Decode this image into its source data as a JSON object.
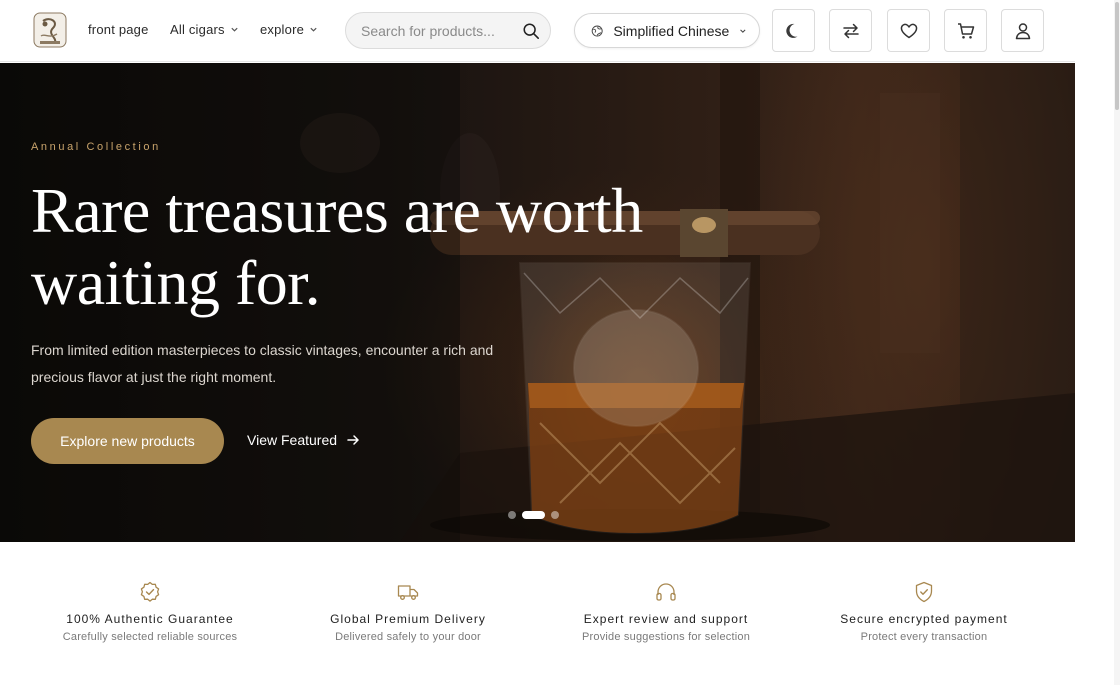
{
  "header": {
    "logo_label": "Cigar shop logo",
    "nav": [
      {
        "label": "front page",
        "has_dropdown": false
      },
      {
        "label": "All cigars",
        "has_dropdown": true
      },
      {
        "label": "explore",
        "has_dropdown": true
      }
    ],
    "search": {
      "placeholder": "Search for products...",
      "value": ""
    },
    "language": {
      "label": "Simplified Chinese"
    },
    "icons": [
      "moon-icon",
      "compare-icon",
      "heart-icon",
      "cart-icon",
      "user-icon"
    ]
  },
  "hero": {
    "eyebrow": "Annual Collection",
    "headline_line1": "Rare treasures are worth",
    "headline_line2": "waiting for.",
    "subtext": "From limited edition masterpieces to classic vintages, encounter a rich and precious flavor at just the right moment.",
    "primary_cta": "Explore new products",
    "secondary_cta": "View Featured",
    "slides": {
      "count": 3,
      "active": 2
    }
  },
  "features": [
    {
      "title": "100% Authentic Guarantee",
      "description": "Carefully selected reliable sources",
      "icon": "badge-check-icon"
    },
    {
      "title": "Global Premium Delivery",
      "description": "Delivered safely to your door",
      "icon": "truck-icon"
    },
    {
      "title": "Expert review and support",
      "description": "Provide suggestions for selection",
      "icon": "headphones-icon"
    },
    {
      "title": "Secure encrypted payment",
      "description": "Protect every transaction",
      "icon": "shield-check-icon"
    }
  ],
  "colors": {
    "accent": "#a88850",
    "eyebrow": "#c9a46c",
    "icon": "#a88850"
  }
}
